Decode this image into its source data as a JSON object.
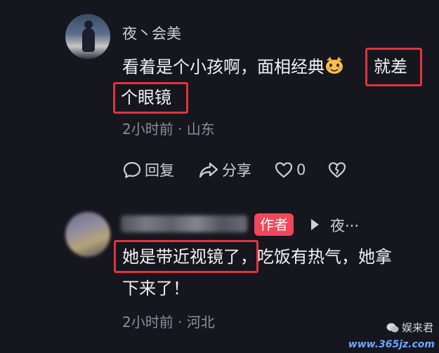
{
  "comment1": {
    "username": "夜丶会美",
    "line1_text": "看着是个小孩啊，面相经典",
    "emoji": "cat-face-emoji",
    "line1_highlight": "就差",
    "line2_highlight": "个眼镜",
    "meta": "2小时前 · 山东",
    "actions": {
      "reply": "回复",
      "share": "分享",
      "like_count": "0"
    }
  },
  "comment2": {
    "author_badge": "作者",
    "reply_to": "夜···",
    "line1_highlight": "她是带近视镜了",
    "line1_rest": "，吃饭有热气，她拿",
    "line2_text": "下来了！",
    "meta": "2小时前 · 河北"
  },
  "watermark": {
    "label": "娱来君",
    "url": "www.365jz.com"
  },
  "colors": {
    "background": "#16161e",
    "highlight_box": "#e2333d",
    "author_badge": "#f0475a",
    "meta_text": "#8e8e99"
  }
}
